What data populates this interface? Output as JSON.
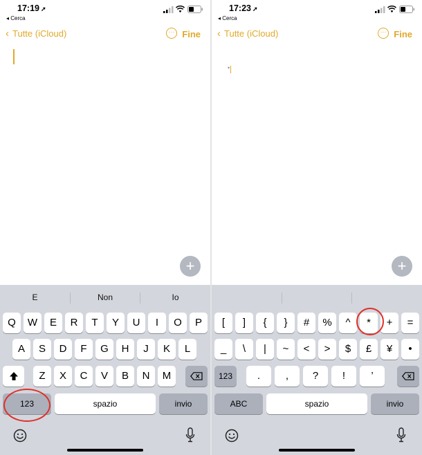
{
  "left": {
    "status": {
      "time": "17:19",
      "back_app": "◂ Cerca"
    },
    "nav": {
      "back_label": "Tutte (iCloud)",
      "more_glyph": "···",
      "done_label": "Fine"
    },
    "suggestions": [
      "E",
      "Non",
      "Io"
    ],
    "row1": [
      "Q",
      "W",
      "E",
      "R",
      "T",
      "Y",
      "U",
      "I",
      "O",
      "P"
    ],
    "row2": [
      "A",
      "S",
      "D",
      "F",
      "G",
      "H",
      "J",
      "K",
      "L"
    ],
    "row3": [
      "Z",
      "X",
      "C",
      "V",
      "B",
      "N",
      "M"
    ],
    "bottom": {
      "numbers": "123",
      "space": "spazio",
      "return": "invio"
    }
  },
  "right": {
    "status": {
      "time": "17:23",
      "back_app": "◂ Cerca"
    },
    "nav": {
      "back_label": "Tutte (iCloud)",
      "more_glyph": "···",
      "done_label": "Fine"
    },
    "typed_text": "*",
    "row1": [
      "[",
      "]",
      "{",
      "}",
      "#",
      "%",
      "^",
      "*",
      "+",
      "="
    ],
    "row2": [
      "_",
      "\\",
      "|",
      "~",
      "<",
      ">",
      "$",
      "£",
      "¥",
      "•"
    ],
    "row3_mode": "123",
    "row3": [
      ".",
      ",",
      "?",
      "!",
      "’"
    ],
    "bottom": {
      "letters": "ABC",
      "space": "spazio",
      "return": "invio"
    }
  },
  "icons": [
    "location-arrow-icon",
    "signal-icon",
    "wifi-icon",
    "battery-icon",
    "chevron-left-icon",
    "ellipsis-circle-icon",
    "plus-icon",
    "shift-icon",
    "delete-icon",
    "emoji-icon",
    "microphone-icon"
  ],
  "colors": {
    "accent": "#e0a92b",
    "keyboard_bg": "#d3d6dd",
    "key": "#ffffff",
    "dark_key": "#abb0bb",
    "annotation_ring": "#e0302a"
  }
}
